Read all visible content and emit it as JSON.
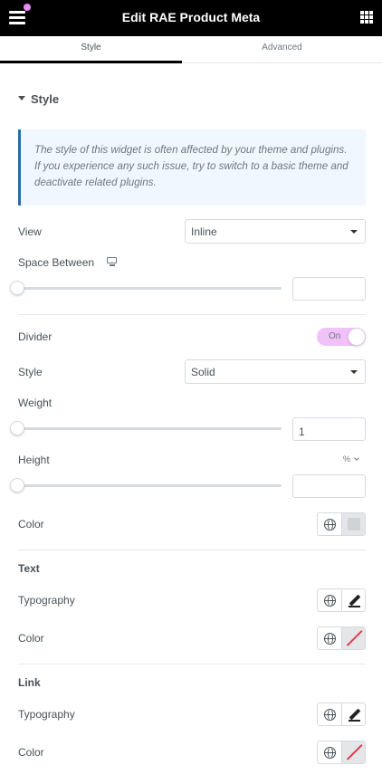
{
  "header": {
    "title": "Edit RAE Product Meta",
    "menu_icon": "hamburger-icon",
    "apps_icon": "grid-icon",
    "notification_dot_color": "#e78cf6"
  },
  "tabs": [
    {
      "label": "Style",
      "active": true
    },
    {
      "label": "Advanced",
      "active": false
    }
  ],
  "section": {
    "title": "Style",
    "notice": "The style of this widget is often affected by your theme and plugins. If you experience any such issue, try to switch to a basic theme and deactivate related plugins."
  },
  "controls": {
    "view": {
      "label": "View",
      "value": "Inline"
    },
    "space_between": {
      "label": "Space Between",
      "device_icon": "desktop-icon",
      "value": ""
    },
    "divider": {
      "label": "Divider",
      "toggle_text": "On",
      "enabled": true
    },
    "style": {
      "label": "Style",
      "value": "Solid"
    },
    "weight": {
      "label": "Weight",
      "value": "1"
    },
    "height": {
      "label": "Height",
      "unit": "%",
      "value": ""
    },
    "divider_color": {
      "label": "Color"
    }
  },
  "text_section": {
    "title": "Text",
    "typography": {
      "label": "Typography"
    },
    "color": {
      "label": "Color"
    }
  },
  "link_section": {
    "title": "Link",
    "typography": {
      "label": "Typography"
    },
    "color": {
      "label": "Color"
    }
  },
  "colors": {
    "accent_toggle": "#f1c1f9",
    "notice_border": "#2b6ca3",
    "notice_bg": "#f0f7ff",
    "none_slash": "#e03b52"
  }
}
